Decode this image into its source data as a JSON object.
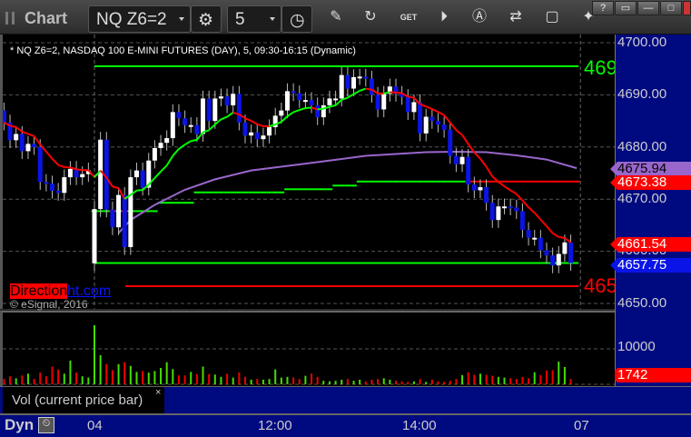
{
  "window": {
    "title": "Chart",
    "buttons": [
      "?",
      "▭",
      "—",
      "□",
      "X"
    ]
  },
  "toolbar": {
    "symbol": "NQ Z6=2",
    "interval": "5",
    "icons": [
      "settings-icon",
      "clock-icon",
      "pencil-icon",
      "refresh-chart-icon",
      "get-icon",
      "play-icon",
      "alert-icon",
      "link-icon",
      "comment-icon",
      "twitter-icon"
    ]
  },
  "chart": {
    "description": "* NQ Z6=2, NASDAQ 100 E-MINI FUTURES (DAY), 5, 09:30-16:15 (Dynamic)",
    "copyright": "© eSignal, 2016",
    "brand": {
      "part1": "Direction",
      "part2": "ht.com"
    },
    "cut_labels": {
      "upper": "469",
      "lower": "465"
    }
  },
  "price_axis": {
    "ticks": [
      "4700.00",
      "4690.00",
      "4680.00",
      "4670.00",
      "4660.00",
      "4650.00"
    ],
    "badges": [
      {
        "value": "4675.94",
        "color": "#9966cc",
        "text": "#000"
      },
      {
        "value": "4673.38",
        "color": "#ff0000",
        "text": "#fff"
      },
      {
        "value": "4661.54",
        "color": "#ff0000",
        "text": "#fff"
      },
      {
        "value": "4657.75",
        "color": "#0a14e6",
        "text": "#fff"
      }
    ]
  },
  "volume": {
    "legend": "Vol (current price bar)",
    "close_icon": "×",
    "tick": "10000",
    "last": "1742"
  },
  "time_axis": {
    "labels": [
      "04",
      "12:00",
      "14:00",
      "07"
    ],
    "mode": "Dyn"
  },
  "chart_data": {
    "type": "candlestick",
    "ylim": [
      4647,
      4702
    ],
    "prior_session": {
      "first_open": 4687,
      "close": [
        4684.7,
        4681.3,
        4682.5,
        4679.2,
        4680.6,
        4680,
        4673.3,
        4673,
        4671.6,
        4671.2,
        4674.2,
        4675.8,
        4674.2,
        4674.8,
        4675.5
      ],
      "volume": [
        1500,
        2250,
        1700,
        2500,
        3000,
        1500,
        3300,
        2250,
        5000,
        4200,
        3000,
        6700,
        3300,
        2250,
        1900
      ]
    },
    "session": {
      "first_open": 4657.7,
      "close": [
        4668.1,
        4681.4,
        4668,
        4664.6,
        4670.8,
        4660.8,
        4674.2,
        4675.5,
        4672.2,
        4677.4,
        4679.8,
        4680.8,
        4681.7,
        4686.7,
        4685.5,
        4684.2,
        4684.2,
        4682.5,
        4689.3,
        4685,
        4689.3,
        4689.7,
        4688,
        4690.2,
        4684.7,
        4682.2,
        4682.8,
        4681.5,
        4682.2,
        4683.8,
        4686,
        4687,
        4690.7,
        4690.3,
        4689,
        4689,
        4688,
        4685.7,
        4688,
        4689.3,
        4689.3,
        4693.8,
        4691.2,
        4693.4,
        4693.5,
        4693.1,
        4690,
        4687.2,
        4690.2,
        4691.6,
        4690.2,
        4689.6,
        4686.7,
        4688.6,
        4682.6,
        4685.8,
        4685,
        4684.3,
        4683.3,
        4678.3,
        4676.7,
        4678.1,
        4672.8,
        4671.7,
        4672.3,
        4669.3,
        4666,
        4668.6,
        4668.6,
        4668.4,
        4667.7,
        4664.1,
        4662.6,
        4662.6,
        4660.2,
        4659.2,
        4657.3,
        4659.5,
        4661.7,
        4657.75
      ],
      "volume": [
        16700,
        8200,
        5700,
        4000,
        5700,
        6250,
        5200,
        3500,
        3750,
        3300,
        3750,
        4600,
        6250,
        4300,
        2500,
        2500,
        3500,
        2900,
        5000,
        2900,
        2750,
        2100,
        3000,
        1900,
        3400,
        2100,
        1300,
        1500,
        1300,
        1500,
        4200,
        1900,
        2100,
        1900,
        1500,
        2400,
        3000,
        2100,
        1000,
        850,
        1000,
        1300,
        1500,
        1000,
        1300,
        850,
        1300,
        1500,
        1700,
        1300,
        1000,
        850,
        700,
        850,
        1500,
        700,
        1300,
        850,
        700,
        1000,
        1500,
        2600,
        3400,
        2700,
        3000,
        2700,
        2400,
        2100,
        1900,
        1700,
        1500,
        2100,
        1700,
        3400,
        2600,
        3900,
        4000,
        6400,
        4900,
        1500,
        1742
      ]
    },
    "purple_line": [
      [
        4,
        4663.5
      ],
      [
        6,
        4666
      ],
      [
        10,
        4668.9
      ],
      [
        15,
        4671.8
      ],
      [
        20,
        4673.8
      ],
      [
        26,
        4675.5
      ],
      [
        35,
        4676.8
      ],
      [
        45,
        4678.3
      ],
      [
        55,
        4679
      ],
      [
        60,
        4679.1
      ],
      [
        65,
        4679
      ],
      [
        70,
        4678.4
      ],
      [
        75,
        4677.6
      ],
      [
        80,
        4675.94
      ]
    ],
    "step_line": [
      [
        0,
        4667.7
      ],
      [
        11,
        4669.3
      ],
      [
        17,
        4671.3
      ],
      [
        32,
        4671.9
      ],
      [
        40,
        4672.6
      ],
      [
        44,
        4673.38
      ]
    ],
    "levels": [
      {
        "value": 4695.5,
        "color": "#00ff00"
      },
      {
        "value": 4657.75,
        "color": "#00ff00"
      },
      {
        "value": 4653.3,
        "color": "#ff0000"
      }
    ],
    "colors": {
      "up": "#ffffff",
      "down": "#0a14e6",
      "vol_up": "#44dd00",
      "vol_down": "#ee0000",
      "ma_up": "#00ff00",
      "ma_down": "#ff0000",
      "vwap": "#9966cc"
    }
  }
}
